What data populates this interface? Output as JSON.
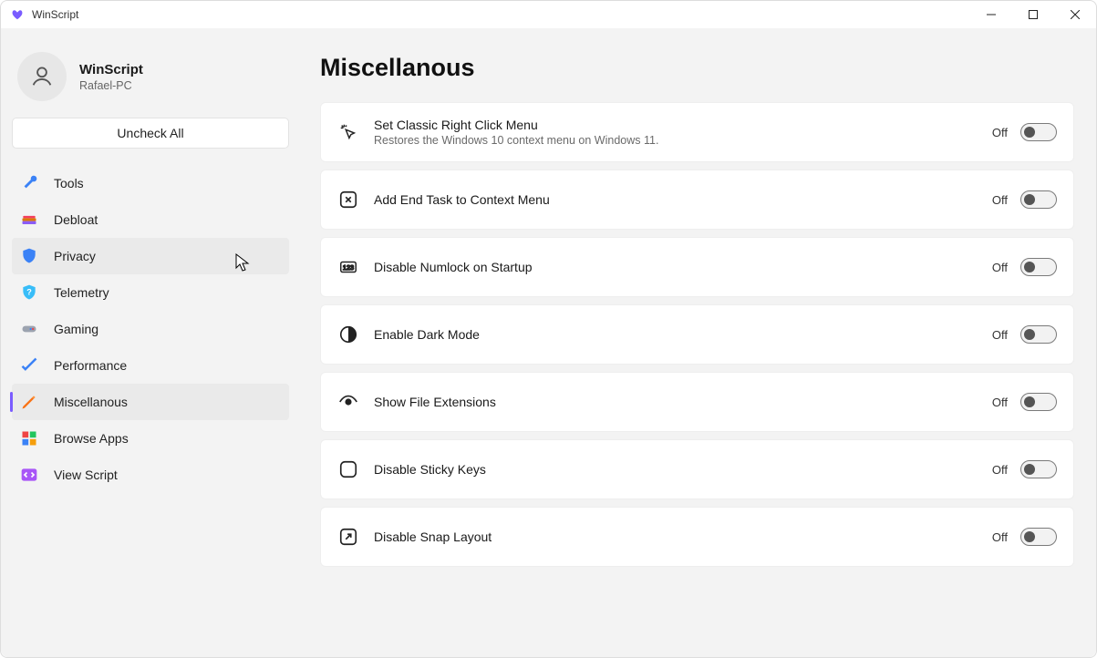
{
  "window": {
    "title": "WinScript"
  },
  "profile": {
    "name": "WinScript",
    "sub": "Rafael-PC"
  },
  "uncheck_label": "Uncheck All",
  "nav": [
    {
      "id": "tools",
      "label": "Tools"
    },
    {
      "id": "debloat",
      "label": "Debloat"
    },
    {
      "id": "privacy",
      "label": "Privacy"
    },
    {
      "id": "telemetry",
      "label": "Telemetry"
    },
    {
      "id": "gaming",
      "label": "Gaming"
    },
    {
      "id": "performance",
      "label": "Performance"
    },
    {
      "id": "miscellanous",
      "label": "Miscellanous"
    },
    {
      "id": "browseapps",
      "label": "Browse Apps"
    },
    {
      "id": "viewscript",
      "label": "View Script"
    }
  ],
  "page": {
    "title": "Miscellanous"
  },
  "items": [
    {
      "id": "classic-menu",
      "title": "Set Classic Right Click Menu",
      "desc": "Restores the Windows 10 context menu on Windows 11.",
      "state": "Off"
    },
    {
      "id": "end-task",
      "title": "Add End Task to Context Menu",
      "state": "Off"
    },
    {
      "id": "numlock",
      "title": "Disable Numlock on Startup",
      "state": "Off"
    },
    {
      "id": "dark-mode",
      "title": "Enable Dark Mode",
      "state": "Off"
    },
    {
      "id": "file-ext",
      "title": "Show File Extensions",
      "state": "Off"
    },
    {
      "id": "sticky-keys",
      "title": "Disable Sticky Keys",
      "state": "Off"
    },
    {
      "id": "snap-layout",
      "title": "Disable Snap Layout",
      "state": "Off"
    }
  ]
}
